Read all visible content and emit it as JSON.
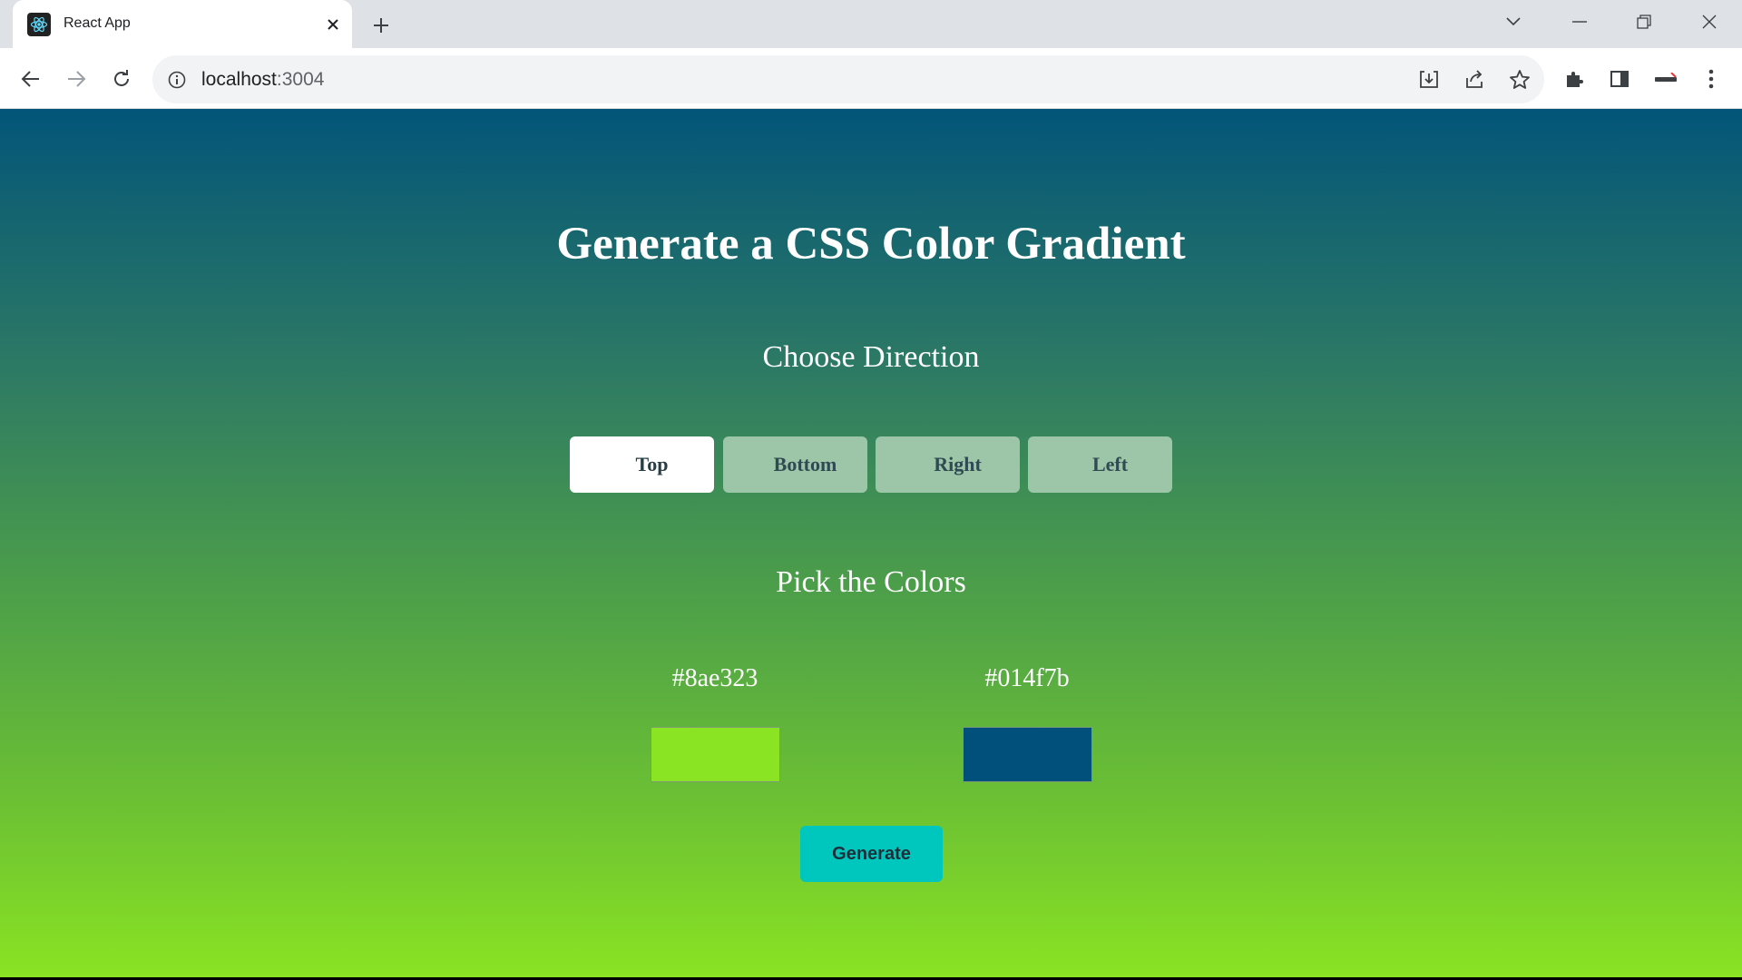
{
  "browser": {
    "tab_title": "React App",
    "url_host": "localhost",
    "url_port": ":3004"
  },
  "page": {
    "title": "Generate a CSS Color Gradient",
    "direction_heading": "Choose Direction",
    "directions": [
      {
        "label": "Top",
        "active": true
      },
      {
        "label": "Bottom",
        "active": false
      },
      {
        "label": "Right",
        "active": false
      },
      {
        "label": "Left",
        "active": false
      }
    ],
    "colors_heading": "Pick the Colors",
    "colors": [
      {
        "label": "#8ae323",
        "value": "#8ae323"
      },
      {
        "label": "#014f7b",
        "value": "#014f7b"
      }
    ],
    "generate_label": "Generate"
  },
  "theme": {
    "gradient_top": "#035579",
    "gradient_bottom": "#8ae323",
    "button_accent": "#00c7bd",
    "inactive_direction": "#9cc6a7"
  }
}
